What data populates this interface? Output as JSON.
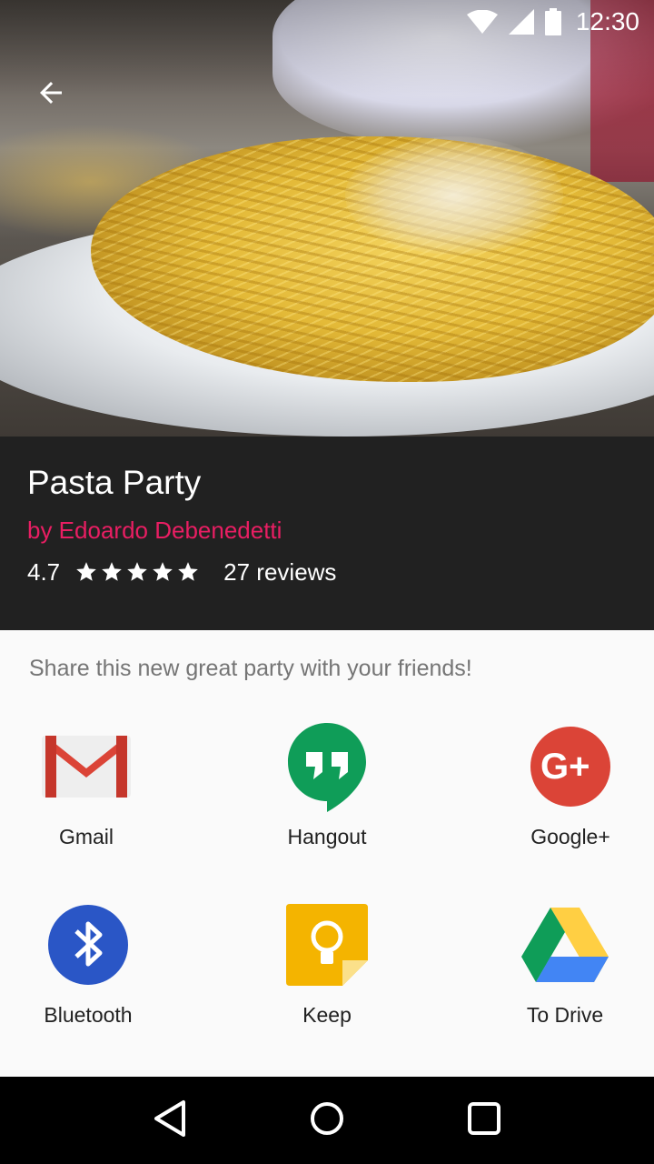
{
  "status_bar": {
    "time": "12:30",
    "icons": [
      "wifi-icon",
      "cell-signal-icon",
      "battery-icon"
    ]
  },
  "header": {
    "back_icon": "arrow-back-icon"
  },
  "recipe": {
    "title": "Pasta Party",
    "author": "by Edoardo Debenedetti",
    "rating": "4.7",
    "stars": 5,
    "reviews": "27 reviews"
  },
  "share": {
    "prompt": "Share this new great party with your friends!",
    "apps": [
      {
        "label": "Gmail",
        "icon": "gmail-icon"
      },
      {
        "label": "Hangout",
        "icon": "hangouts-icon"
      },
      {
        "label": "Google+",
        "icon": "google-plus-icon"
      },
      {
        "label": "Bluetooth",
        "icon": "bluetooth-icon"
      },
      {
        "label": "Keep",
        "icon": "keep-icon"
      },
      {
        "label": "To Drive",
        "icon": "drive-icon"
      }
    ]
  },
  "nav_bar": {
    "buttons": [
      "back-triangle-icon",
      "home-circle-icon",
      "recents-square-icon"
    ]
  },
  "colors": {
    "accent": "#e91e63",
    "panel": "#212121",
    "sheet": "#fafafa"
  }
}
